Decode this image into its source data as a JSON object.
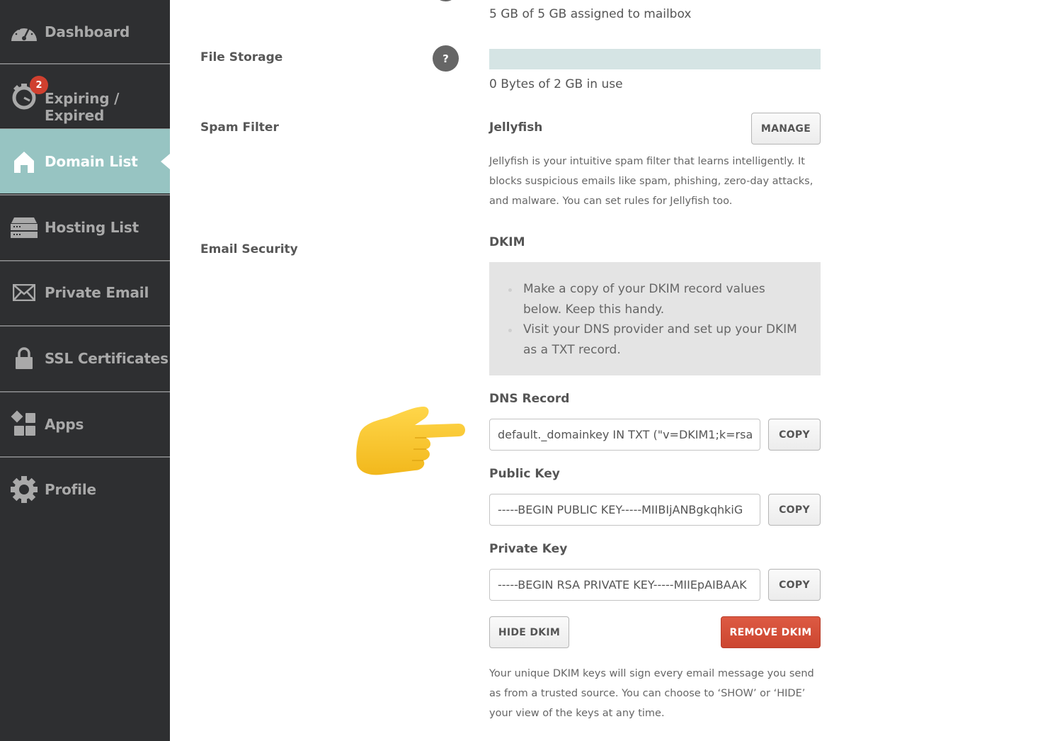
{
  "sidebar": {
    "items": [
      {
        "label": "Dashboard",
        "icon": "dashboard-gauge-icon",
        "active": false
      },
      {
        "label": "Expiring / Expired",
        "icon": "stopwatch-icon",
        "badge": "2",
        "active": false
      },
      {
        "label": "Domain List",
        "icon": "home-icon",
        "active": true
      },
      {
        "label": "Hosting List",
        "icon": "server-icon",
        "active": false
      },
      {
        "label": "Private Email",
        "icon": "envelope-icon",
        "active": false
      },
      {
        "label": "SSL Certificates",
        "icon": "lock-icon",
        "active": false
      },
      {
        "label": "Apps",
        "icon": "apps-grid-icon",
        "active": false
      },
      {
        "label": "Profile",
        "icon": "gear-icon",
        "active": false
      }
    ],
    "colors": {
      "background": "#2e2f31",
      "active": "#97c4c2",
      "badge": "#d0402f"
    }
  },
  "main": {
    "mailbox_usage_text": "5 GB of 5 GB assigned to mailbox",
    "file_storage": {
      "label": "File Storage",
      "help": "?",
      "usage_fraction": 0,
      "usage_text": "0 Bytes of 2 GB in use"
    },
    "spam_filter": {
      "label": "Spam Filter",
      "name": "Jellyfish",
      "manage_button": "MANAGE",
      "description": "Jellyfish is your intuitive spam filter that learns intelligently. It blocks suspicious emails like spam, phishing, zero-day attacks, and malware. You can set rules for Jellyfish too."
    },
    "email_security": {
      "label": "Email Security",
      "heading": "DKIM",
      "instructions": [
        "Make a copy of your DKIM record values below. Keep this handy.",
        "Visit your DNS provider and set up your DKIM as a TXT record."
      ],
      "fields": [
        {
          "label": "DNS Record",
          "value": "default._domainkey IN TXT (\"v=DKIM1;k=rsa",
          "copy_button": "COPY"
        },
        {
          "label": "Public Key",
          "value": "-----BEGIN PUBLIC KEY-----MIIBIjANBgkqhkiG",
          "copy_button": "COPY"
        },
        {
          "label": "Private Key",
          "value": "-----BEGIN RSA PRIVATE KEY-----MIIEpAIBAAK",
          "copy_button": "COPY"
        }
      ],
      "hide_button": "HIDE DKIM",
      "remove_button": "REMOVE DKIM",
      "footer_note": "Your unique DKIM keys will sign every email message you send as from a trusted source. You can choose to ‘SHOW’ or ‘HIDE’ your view of the keys at any time.",
      "colors": {
        "remove": "#d64f38"
      }
    },
    "annotation_emoji": "backhand-index-pointing-right"
  }
}
